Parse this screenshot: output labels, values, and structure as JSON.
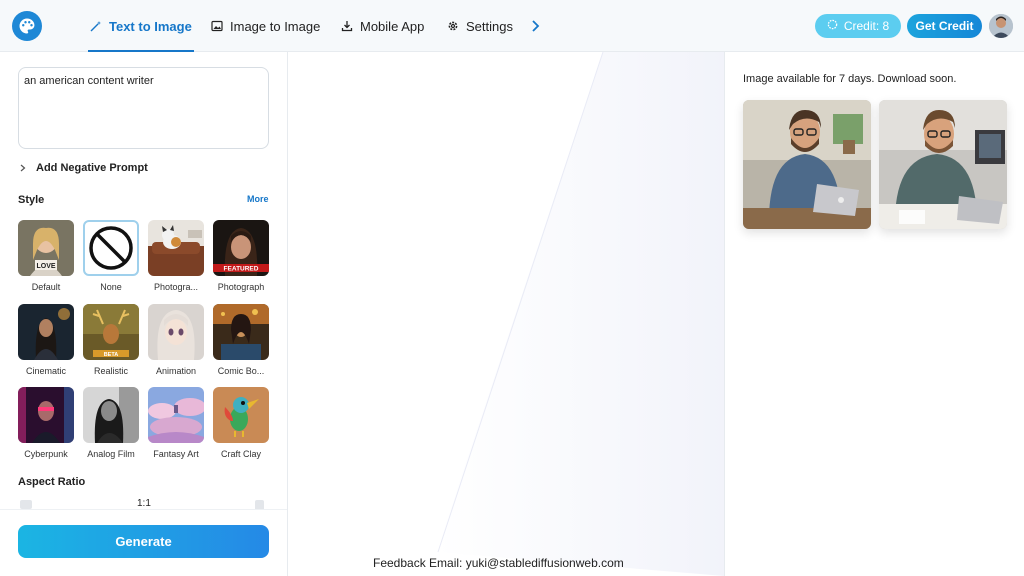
{
  "nav": {
    "tabs": [
      {
        "label": "Text to Image",
        "icon": "magic-wand-icon"
      },
      {
        "label": "Image to Image",
        "icon": "image-icon"
      },
      {
        "label": "Mobile App",
        "icon": "download-icon"
      },
      {
        "label": "Settings",
        "icon": "gear-icon"
      }
    ],
    "credit_label": "Credit: 8",
    "get_credit_label": "Get Credit"
  },
  "prompt": {
    "value": "an american content writer"
  },
  "negative_prompt_label": "Add Negative Prompt",
  "style": {
    "title": "Style",
    "more_label": "More",
    "items": [
      {
        "label": "Default"
      },
      {
        "label": "None",
        "selected": true
      },
      {
        "label": "Photogra..."
      },
      {
        "label": "Photograph"
      },
      {
        "label": "Cinematic"
      },
      {
        "label": "Realistic"
      },
      {
        "label": "Animation"
      },
      {
        "label": "Comic Bo..."
      },
      {
        "label": "Cyberpunk"
      },
      {
        "label": "Analog Film"
      },
      {
        "label": "Fantasy Art"
      },
      {
        "label": "Craft Clay"
      }
    ]
  },
  "aspect_ratio": {
    "title": "Aspect Ratio",
    "value": "1:1"
  },
  "generate_label": "Generate",
  "footer": {
    "feedback": "Feedback Email: yuki@stablediffusionweb.com"
  },
  "results": {
    "notice": "Image available for 7 days. Download soon."
  },
  "colors": {
    "accent": "#1677c9",
    "credit": "#5ccdf0",
    "button_gradient_start": "#1bb5e3",
    "button_gradient_end": "#2589e6"
  }
}
